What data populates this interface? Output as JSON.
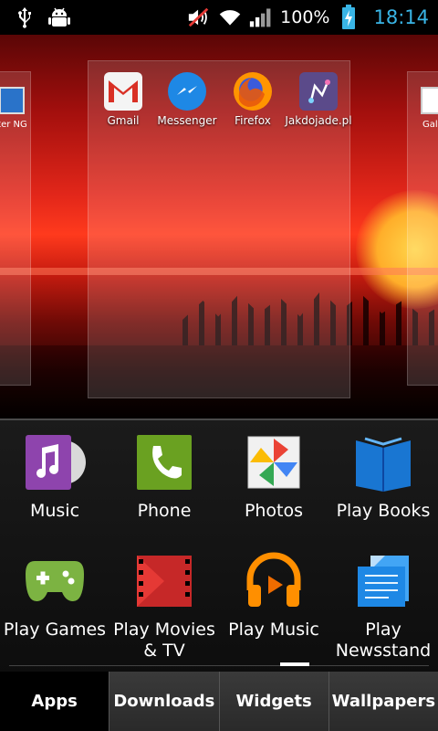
{
  "status_bar": {
    "battery_percent": "100%",
    "time": "18:14",
    "icons": [
      "usb-icon",
      "android-debug-icon",
      "volume-muted-icon",
      "wifi-icon",
      "signal-icon",
      "battery-charging-icon"
    ]
  },
  "home_preview": {
    "left_panel_label": "eter NG",
    "right_panel_label": "Gal",
    "apps": [
      {
        "label": "Gmail",
        "icon": "gmail-icon"
      },
      {
        "label": "Messenger",
        "icon": "messenger-icon"
      },
      {
        "label": "Firefox",
        "icon": "firefox-icon"
      },
      {
        "label": "Jakdojade.pl",
        "icon": "jakdojade-icon"
      }
    ]
  },
  "drawer": {
    "row1": [
      {
        "label": "Music",
        "icon": "music-icon"
      },
      {
        "label": "Phone",
        "icon": "phone-icon"
      },
      {
        "label": "Photos",
        "icon": "photos-icon"
      },
      {
        "label": "Play Books",
        "icon": "play-books-icon"
      }
    ],
    "row2": [
      {
        "label": "Play Games",
        "icon": "play-games-icon"
      },
      {
        "label": "Play Movies & TV",
        "icon": "play-movies-icon"
      },
      {
        "label": "Play Music",
        "icon": "play-music-icon"
      },
      {
        "label": "Play Newsstand",
        "icon": "play-newsstand-icon"
      }
    ]
  },
  "tabs": [
    "Apps",
    "Downloads",
    "Widgets",
    "Wallpapers"
  ],
  "colors": {
    "clock": "#39b5e6",
    "wallpaper_red": "#e3271a"
  }
}
